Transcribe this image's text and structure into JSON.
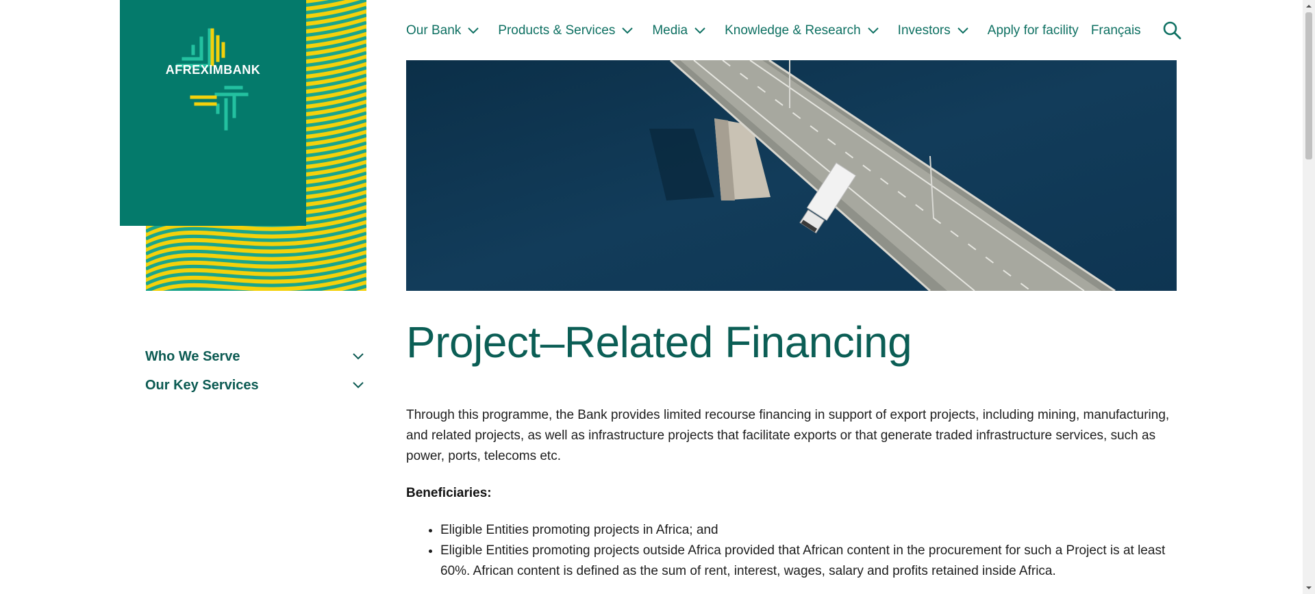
{
  "brand": {
    "name": "AFREXIMBANK"
  },
  "colors": {
    "teal": "#047a6b",
    "yellow": "#f4d10b",
    "navText": "#0e7062",
    "titleText": "#0b5e55"
  },
  "nav": {
    "items": [
      {
        "label": "Our Bank",
        "dropdown": true
      },
      {
        "label": "Products & Services",
        "dropdown": true
      },
      {
        "label": "Media",
        "dropdown": true
      },
      {
        "label": "Knowledge & Research",
        "dropdown": true
      },
      {
        "label": "Investors",
        "dropdown": true
      },
      {
        "label": "Apply for facility",
        "dropdown": false
      },
      {
        "label": "Français",
        "dropdown": false
      }
    ],
    "search_icon": "search-icon"
  },
  "sidebar": {
    "items": [
      {
        "label": "Who We Serve"
      },
      {
        "label": "Our Key Services"
      }
    ]
  },
  "main": {
    "title": "Project–Related Financing",
    "intro": "Through this programme, the Bank provides limited recourse financing in support of export projects, including mining, manufacturing, and related projects, as well as infrastructure projects that facilitate exports or that generate traded infrastructure services, such as power, ports, telecoms etc.",
    "beneficiaries_heading": "Beneficiaries:",
    "beneficiaries": [
      "Eligible Entities promoting projects in Africa; and",
      "Eligible Entities promoting projects outside Africa provided that African content in the procurement for such a Project is at least 60%. African content is defined as the sum of rent, interest, wages, salary and profits retained inside Africa."
    ]
  }
}
